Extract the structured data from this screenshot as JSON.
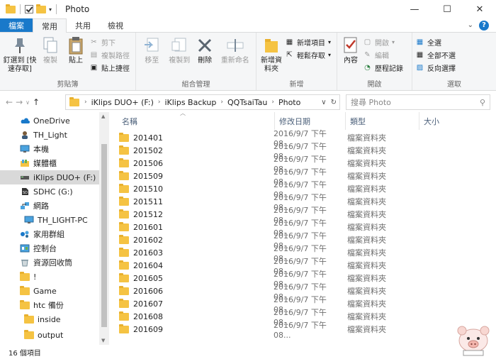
{
  "window": {
    "title": "Photo"
  },
  "ribbon_tabs": {
    "file": "檔案",
    "home": "常用",
    "share": "共用",
    "view": "檢視"
  },
  "ribbon": {
    "clipboard": {
      "label": "剪貼簿",
      "pin": "釘選到 [快速存取]",
      "copy": "複製",
      "paste": "貼上",
      "cut": "剪下",
      "copy_path": "複製路徑",
      "paste_shortcut": "貼上捷徑"
    },
    "organize": {
      "label": "組合管理",
      "move_to": "移至",
      "copy_to": "複製到",
      "delete": "刪除",
      "rename": "重新命名"
    },
    "new": {
      "label": "新增",
      "new_folder": "新增資料夾",
      "new_item": "新增項目",
      "easy_access": "輕鬆存取"
    },
    "open": {
      "label": "開啟",
      "properties": "內容",
      "open": "開啟",
      "edit": "編輯",
      "history": "歷程記錄"
    },
    "select": {
      "label": "選取",
      "select_all": "全選",
      "select_none": "全部不選",
      "invert": "反向選擇"
    }
  },
  "address": {
    "crumbs": [
      "iKlips DUO+ (F:)",
      "iKlips Backup",
      "QQTsaiTau",
      "Photo"
    ]
  },
  "search": {
    "placeholder": "搜尋 Photo"
  },
  "nav": {
    "items": [
      {
        "label": "OneDrive",
        "icon": "cloud-icon"
      },
      {
        "label": "TH_Light",
        "icon": "user-icon"
      },
      {
        "label": "本機",
        "icon": "computer-icon"
      },
      {
        "label": "媒體櫃",
        "icon": "library-icon"
      },
      {
        "label": "iKlips DUO+ (F:)",
        "icon": "usb-drive-icon"
      },
      {
        "label": "SDHC (G:)",
        "icon": "sd-card-icon"
      },
      {
        "label": "網路",
        "icon": "network-icon"
      },
      {
        "label": "TH_LIGHT-PC",
        "icon": "computer-icon"
      },
      {
        "label": "家用群組",
        "icon": "homegroup-icon"
      },
      {
        "label": "控制台",
        "icon": "control-panel-icon"
      },
      {
        "label": "資源回收筒",
        "icon": "recycle-bin-icon"
      },
      {
        "label": "!",
        "icon": "folder-icon"
      },
      {
        "label": "Game",
        "icon": "folder-icon"
      },
      {
        "label": "htc 備份",
        "icon": "folder-icon"
      },
      {
        "label": "inside",
        "icon": "folder-icon"
      },
      {
        "label": "output",
        "icon": "folder-icon"
      }
    ]
  },
  "columns": {
    "name": "名稱",
    "date": "修改日期",
    "type": "類型",
    "size": "大小"
  },
  "files": [
    {
      "name": "201401",
      "date": "2016/9/7 下午 08...",
      "type": "檔案資料夾"
    },
    {
      "name": "201502",
      "date": "2016/9/7 下午 08...",
      "type": "檔案資料夾"
    },
    {
      "name": "201506",
      "date": "2016/9/7 下午 08...",
      "type": "檔案資料夾"
    },
    {
      "name": "201509",
      "date": "2016/9/7 下午 08...",
      "type": "檔案資料夾"
    },
    {
      "name": "201510",
      "date": "2016/9/7 下午 08...",
      "type": "檔案資料夾"
    },
    {
      "name": "201511",
      "date": "2016/9/7 下午 08...",
      "type": "檔案資料夾"
    },
    {
      "name": "201512",
      "date": "2016/9/7 下午 08...",
      "type": "檔案資料夾"
    },
    {
      "name": "201601",
      "date": "2016/9/7 下午 08...",
      "type": "檔案資料夾"
    },
    {
      "name": "201602",
      "date": "2016/9/7 下午 08...",
      "type": "檔案資料夾"
    },
    {
      "name": "201603",
      "date": "2016/9/7 下午 08...",
      "type": "檔案資料夾"
    },
    {
      "name": "201604",
      "date": "2016/9/7 下午 08...",
      "type": "檔案資料夾"
    },
    {
      "name": "201605",
      "date": "2016/9/7 下午 08...",
      "type": "檔案資料夾"
    },
    {
      "name": "201606",
      "date": "2016/9/7 下午 08...",
      "type": "檔案資料夾"
    },
    {
      "name": "201607",
      "date": "2016/9/7 下午 08...",
      "type": "檔案資料夾"
    },
    {
      "name": "201608",
      "date": "2016/9/7 下午 08...",
      "type": "檔案資料夾"
    },
    {
      "name": "201609",
      "date": "2016/9/7 下午 08...",
      "type": "檔案資料夾"
    }
  ],
  "status": {
    "count": "16 個項目"
  },
  "colors": {
    "accent": "#1979ca",
    "folder": "#f5c343",
    "selected": "#d9d9d9"
  }
}
